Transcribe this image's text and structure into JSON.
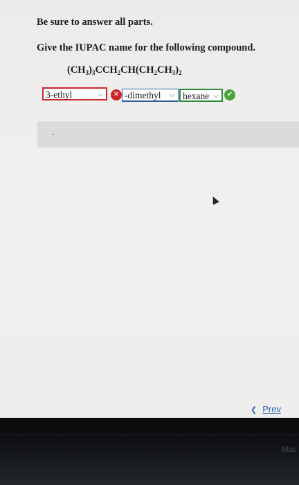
{
  "instructions": "Be sure to answer all parts.",
  "question": "Give the IUPAC name for the following compound.",
  "formula": {
    "p1": "(CH",
    "s1": "3",
    "p2": ")",
    "s2": "3",
    "p3": "CCH",
    "s3": "2",
    "p4": "CH(CH",
    "s4": "2",
    "p5": "CH",
    "s5": "3",
    "p6": ")",
    "s6": "2"
  },
  "answers": {
    "part1": {
      "value": "3-ethyl",
      "status": "incorrect"
    },
    "part2": {
      "value": "-dimethyl",
      "status": "incorrect"
    },
    "part3": {
      "value": "hexane",
      "status": "correct"
    }
  },
  "nav": {
    "prev_label": "Prev"
  },
  "bezel_text": "Mac",
  "colors": {
    "incorrect": "#c9262c",
    "correct": "#4aa33b",
    "link": "#2a66b5",
    "dropdown_blue": "#2d5fa8"
  },
  "icons": {
    "incorrect_mark": "x-circle-icon",
    "correct_mark": "check-circle-icon",
    "dropdown": "chevron-down-icon",
    "prev": "chevron-left-icon"
  }
}
